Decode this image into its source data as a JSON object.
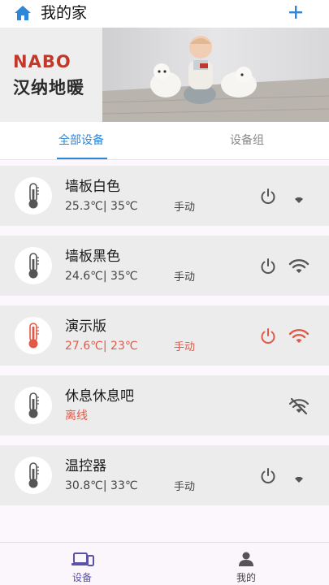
{
  "header": {
    "title": "我的家"
  },
  "banner": {
    "brand_en": "NABO",
    "brand_cn": "汉纳地暖"
  },
  "tabs": {
    "all_devices": "全部设备",
    "device_groups": "设备组"
  },
  "devices": [
    {
      "name": "墙板白色",
      "temp": "25.3℃| 35℃",
      "mode": "手动",
      "state": "normal"
    },
    {
      "name": "墙板黑色",
      "temp": "24.6℃| 35℃",
      "mode": "手动",
      "state": "normal"
    },
    {
      "name": "演示版",
      "temp": "27.6℃| 23℃",
      "mode": "手动",
      "state": "heating"
    },
    {
      "name": "休息休息吧",
      "temp": "离线",
      "mode": "",
      "state": "offline"
    },
    {
      "name": "温控器",
      "temp": "30.8℃| 33℃",
      "mode": "手动",
      "state": "normal"
    }
  ],
  "bottom_nav": {
    "devices": "设备",
    "mine": "我的"
  },
  "colors": {
    "accent": "#2f86d6",
    "alert": "#e05a48",
    "nav_active": "#5a52a8"
  }
}
